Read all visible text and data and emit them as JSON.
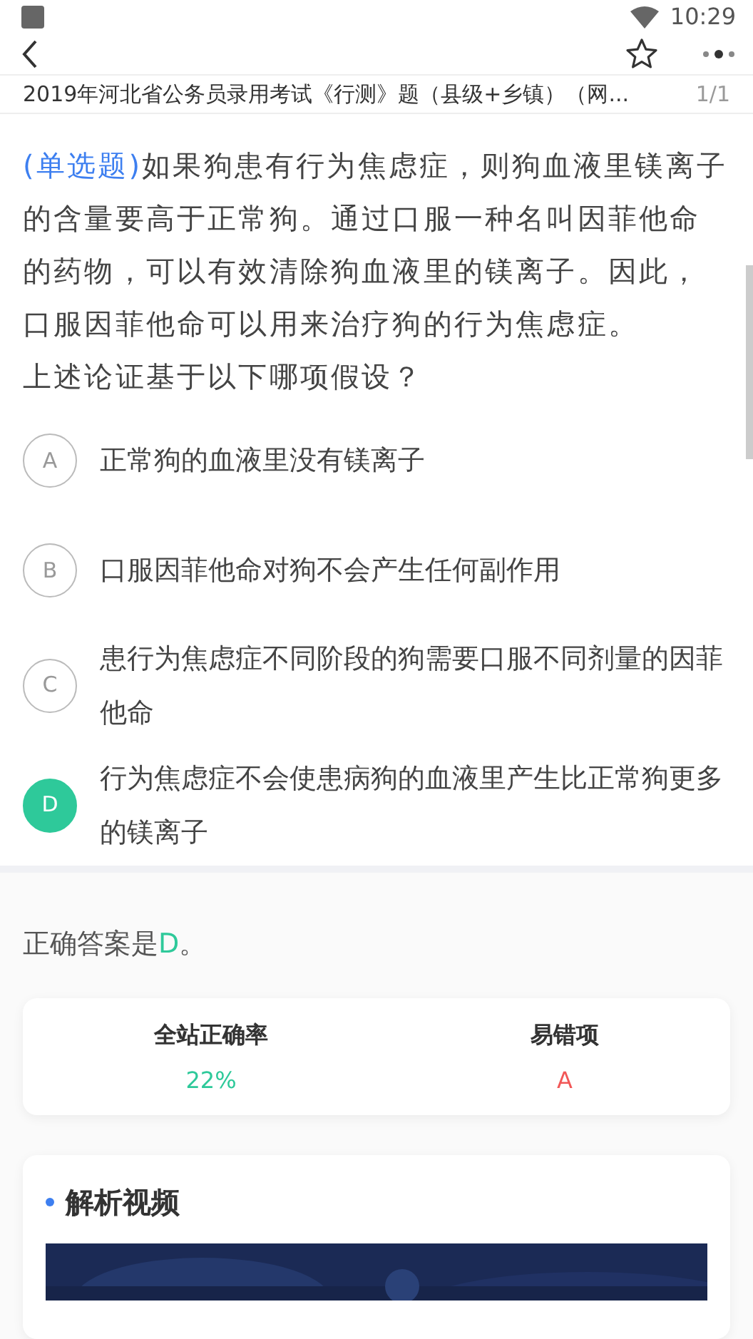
{
  "status_bar": {
    "time": "10:29"
  },
  "header": {
    "title": "2019年河北省公务员录用考试《行测》题（县级+乡镇）（网...",
    "counter": "1/1"
  },
  "question": {
    "type_label": "(单选题)",
    "stem": "如果狗患有行为焦虑症，则狗血液里镁离子的含量要高于正常狗。通过口服一种名叫因菲他命的药物，可以有效清除狗血液里的镁离子。因此，口服因菲他命可以用来治疗狗的行为焦虑症。",
    "prompt": "上述论证基于以下哪项假设？"
  },
  "options": [
    {
      "letter": "A",
      "text": "正常狗的血液里没有镁离子",
      "selected": false
    },
    {
      "letter": "B",
      "text": "口服因菲他命对狗不会产生任何副作用",
      "selected": false
    },
    {
      "letter": "C",
      "text": "患行为焦虑症不同阶段的狗需要口服不同剂量的因菲他命",
      "selected": false
    },
    {
      "letter": "D",
      "text": "行为焦虑症不会使患病狗的血液里产生比正常狗更多的镁离子",
      "selected": true
    }
  ],
  "answer": {
    "prefix": "正确答案是",
    "letter": "D",
    "suffix": "。"
  },
  "stats": [
    {
      "label": "全站正确率",
      "value": "22%",
      "color": "#2ec99a"
    },
    {
      "label": "易错项",
      "value": "A",
      "color": "#f25757"
    }
  ],
  "video_section": {
    "title": "解析视频"
  }
}
